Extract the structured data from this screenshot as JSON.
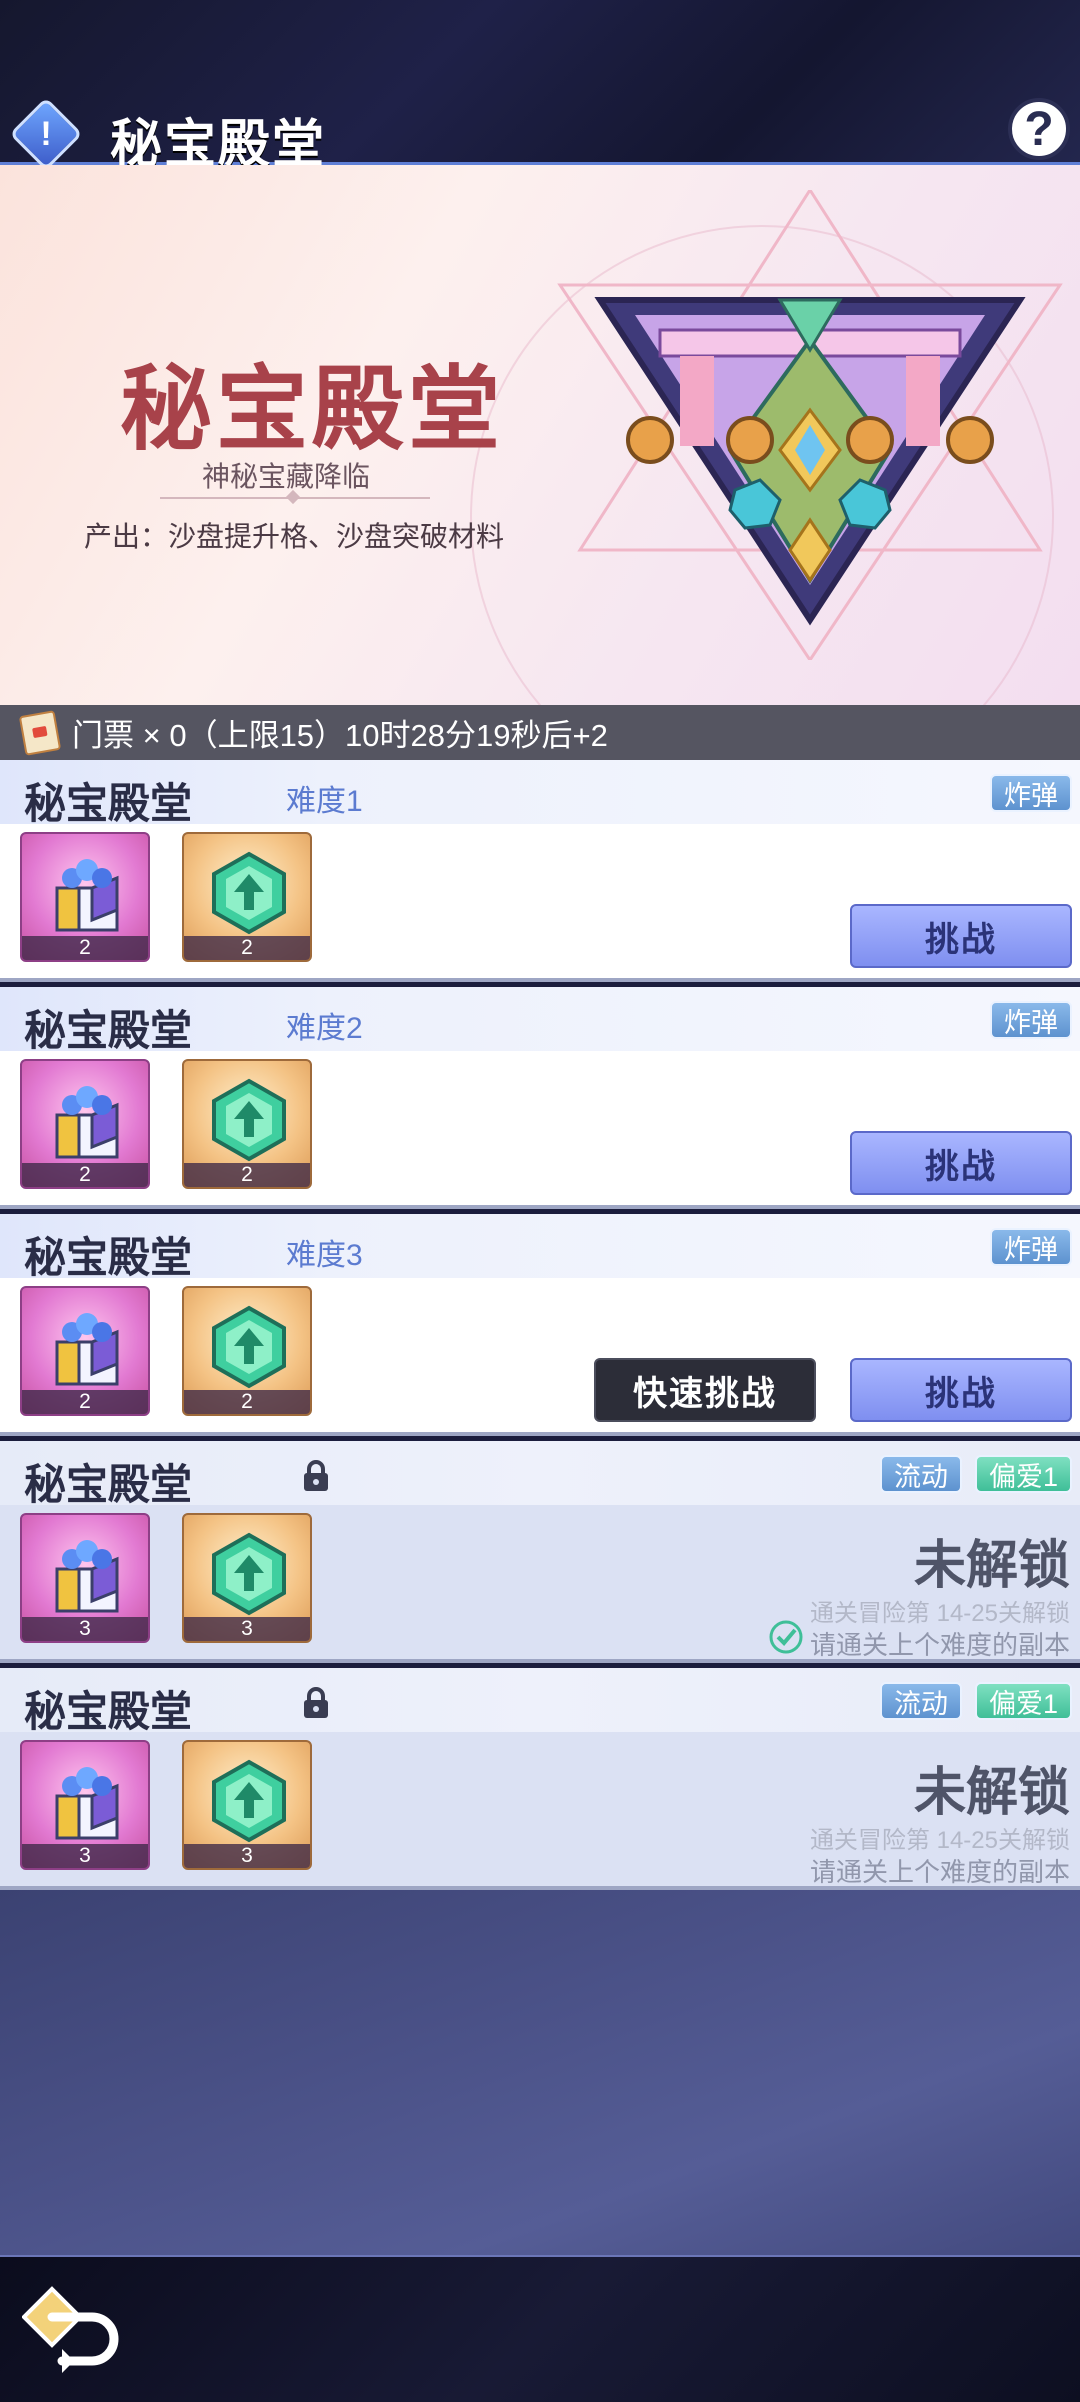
{
  "header": {
    "title": "秘宝殿堂",
    "info_icon_glyph": "!",
    "help_icon_glyph": "?"
  },
  "banner": {
    "title": "秘宝殿堂",
    "subtitle": "神秘宝藏降临",
    "output": "产出：沙盘提升格、沙盘突破材料"
  },
  "ticket": {
    "text": "门票 × 0（上限15）10时28分19秒后+2"
  },
  "levels": [
    {
      "name": "秘宝殿堂",
      "difficulty": "难度1",
      "tags": [
        "炸弹"
      ],
      "rewards": [
        {
          "icon": "chest-icon",
          "count": "2"
        },
        {
          "icon": "upgrade-gem-icon",
          "count": "2"
        }
      ],
      "challenge_label": "挑战",
      "locked": false
    },
    {
      "name": "秘宝殿堂",
      "difficulty": "难度2",
      "tags": [
        "炸弹"
      ],
      "rewards": [
        {
          "icon": "chest-icon",
          "count": "2"
        },
        {
          "icon": "upgrade-gem-icon",
          "count": "2"
        }
      ],
      "challenge_label": "挑战",
      "locked": false
    },
    {
      "name": "秘宝殿堂",
      "difficulty": "难度3",
      "tags": [
        "炸弹"
      ],
      "rewards": [
        {
          "icon": "chest-icon",
          "count": "2"
        },
        {
          "icon": "upgrade-gem-icon",
          "count": "2"
        }
      ],
      "quick_label": "快速挑战",
      "challenge_label": "挑战",
      "locked": false
    },
    {
      "name": "秘宝殿堂",
      "tags": [
        "流动",
        "偏爱1"
      ],
      "rewards": [
        {
          "icon": "chest-icon",
          "count": "3"
        },
        {
          "icon": "upgrade-gem-icon",
          "count": "3"
        }
      ],
      "locked": true,
      "locked_title": "未解锁",
      "condition1": "通关冒险第 14-25关解锁",
      "condition2": "请通关上个难度的副本"
    },
    {
      "name": "秘宝殿堂",
      "tags": [
        "流动",
        "偏爱1"
      ],
      "rewards": [
        {
          "icon": "chest-icon",
          "count": "3"
        },
        {
          "icon": "upgrade-gem-icon",
          "count": "3"
        }
      ],
      "locked": true,
      "locked_title": "未解锁",
      "condition1": "通关冒险第 14-25关解锁",
      "condition2": "请通关上个难度的副本"
    }
  ],
  "colors": {
    "accent_blue": "#7f8ff0",
    "title_red": "#a8424a",
    "tag_blue": "#5d92cf",
    "tag_green": "#3fbf98"
  }
}
